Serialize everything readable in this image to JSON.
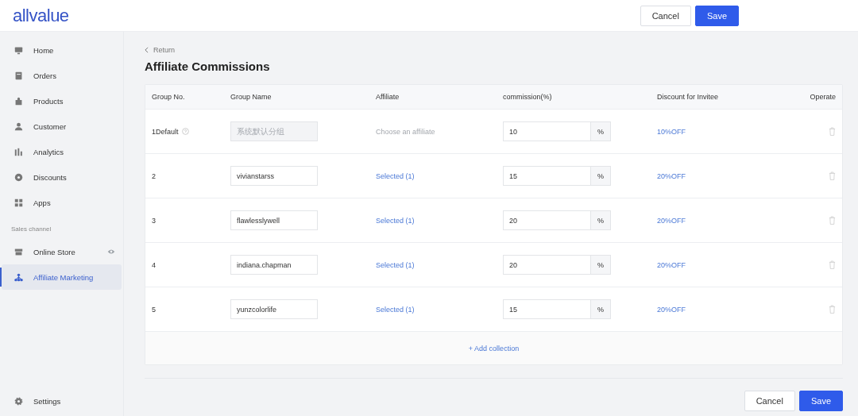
{
  "logo": "all**value**",
  "header_buttons": [
    {
      "label": "Cancel",
      "kind": "secondary"
    },
    {
      "label": "Save",
      "kind": "primary"
    }
  ],
  "sidebar": {
    "items": [
      {
        "label": "Home",
        "selected": false
      },
      {
        "label": "Orders",
        "selected": false
      },
      {
        "label": "Products",
        "selected": false
      },
      {
        "label": "Customer",
        "selected": false
      },
      {
        "label": "Analytics",
        "selected": false
      },
      {
        "label": "Discounts",
        "selected": false
      },
      {
        "label": "Apps",
        "selected": false
      }
    ],
    "section_title": "Sales channel",
    "channels": [
      {
        "label": "Online Store",
        "selected": false,
        "viewable": true
      },
      {
        "label": "Affiliate Marketing",
        "selected": true,
        "viewable": false
      }
    ],
    "settings": "Settings"
  },
  "back_link": "Return",
  "page_title": "Affiliate Commissions",
  "table": {
    "columns": [
      "Group No.",
      "Group Name",
      "Affiliate",
      "commission(%)",
      "Discount for Invitee",
      "Operate"
    ],
    "rows": [
      {
        "group_no": "1Default",
        "help": true,
        "group_name": {
          "placeholder": "系统默认分组",
          "disabled": true
        },
        "affiliate": {
          "text": "Choose an affiliate",
          "kind": "placeholder"
        },
        "commission": "10",
        "unit": "%",
        "discount": "10%OFF"
      },
      {
        "group_no": "2",
        "help": false,
        "group_name": {
          "value": "vivianstarss",
          "disabled": false
        },
        "affiliate": {
          "text": "Selected (1)",
          "kind": "link"
        },
        "commission": "15",
        "unit": "%",
        "discount": "20%OFF"
      },
      {
        "group_no": "3",
        "help": false,
        "group_name": {
          "value": "flawlesslywell",
          "disabled": false
        },
        "affiliate": {
          "text": "Selected (1)",
          "kind": "link"
        },
        "commission": "20",
        "unit": "%",
        "discount": "20%OFF"
      },
      {
        "group_no": "4",
        "help": false,
        "group_name": {
          "value": "indiana.chapman",
          "disabled": false
        },
        "affiliate": {
          "text": "Selected (1)",
          "kind": "link"
        },
        "commission": "20",
        "unit": "%",
        "discount": "20%OFF"
      },
      {
        "group_no": "5",
        "help": false,
        "group_name": {
          "value": "yunzcolorlife",
          "disabled": false
        },
        "affiliate": {
          "text": "Selected (1)",
          "kind": "link"
        },
        "commission": "15",
        "unit": "%",
        "discount": "20%OFF"
      }
    ],
    "add_button": "+ Add collection"
  },
  "footer_buttons": [
    {
      "label": "Cancel",
      "kind": "secondary"
    },
    {
      "label": "Save",
      "kind": "primary"
    }
  ]
}
